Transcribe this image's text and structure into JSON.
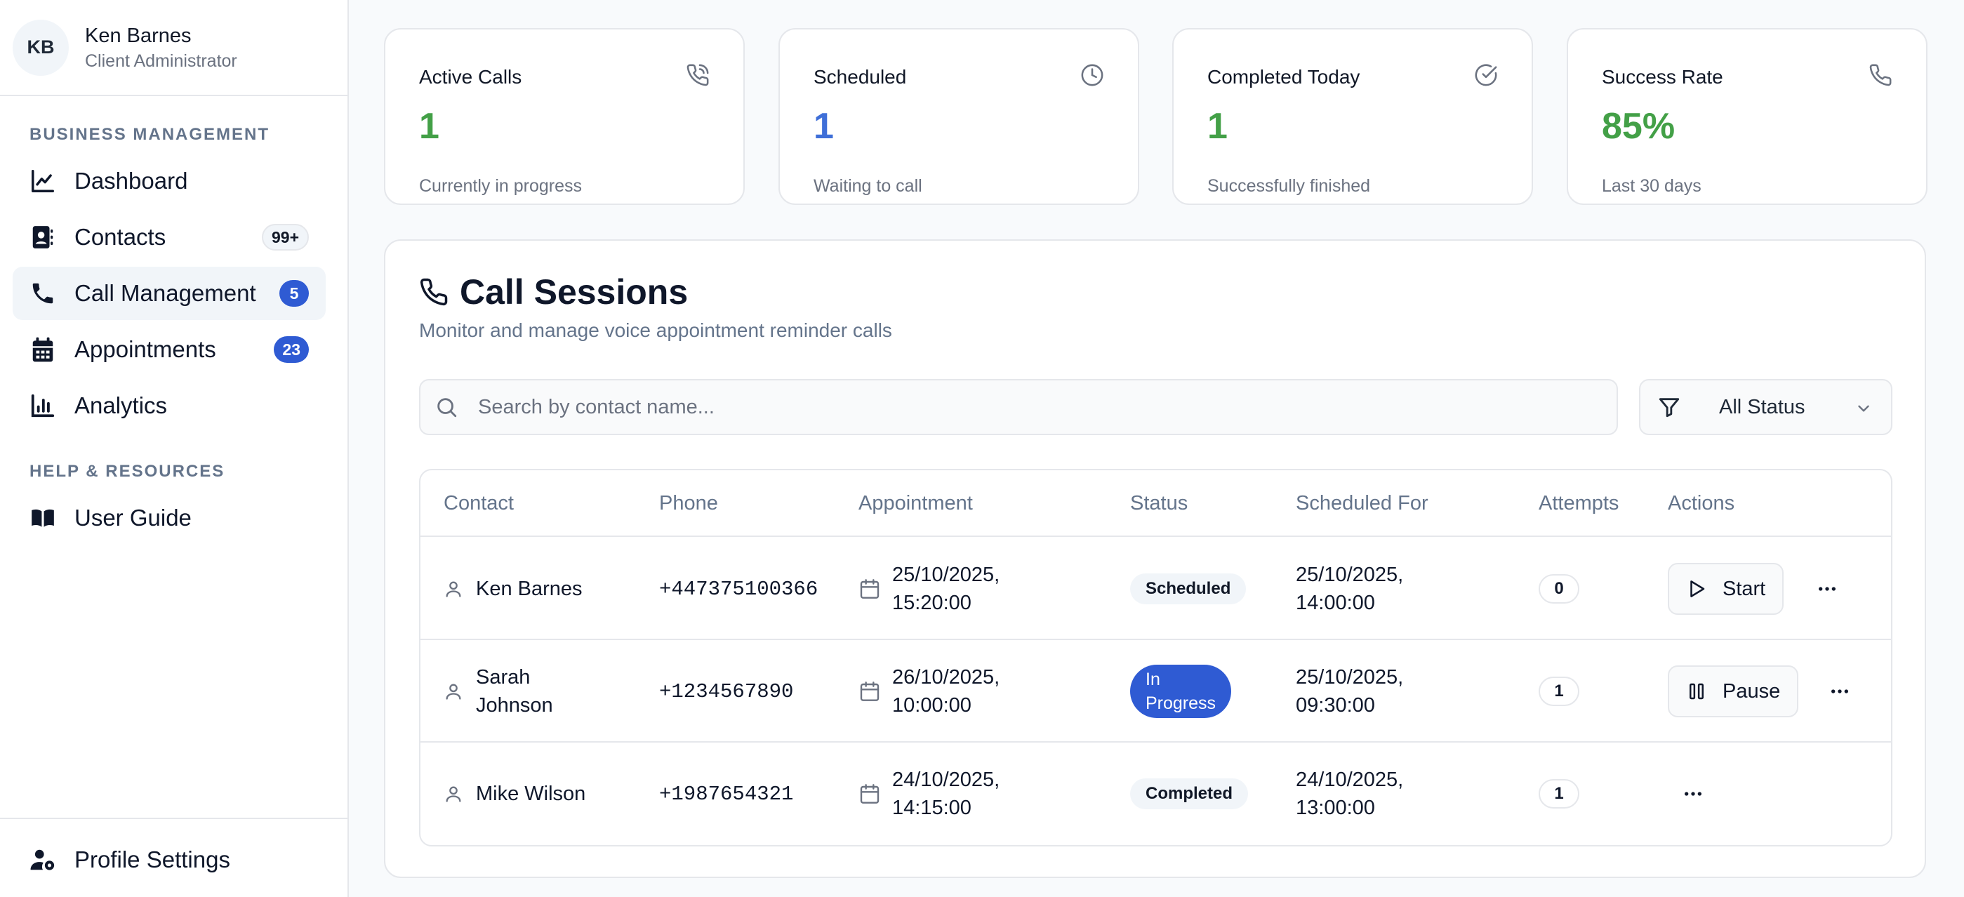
{
  "user": {
    "initials": "KB",
    "name": "Ken Barnes",
    "role": "Client Administrator"
  },
  "sidebar": {
    "section_business": "BUSINESS MANAGEMENT",
    "section_help": "HELP & RESOURCES",
    "items": [
      {
        "label": "Dashboard",
        "icon": "chart-line-icon"
      },
      {
        "label": "Contacts",
        "icon": "contacts-icon",
        "badge": "99+"
      },
      {
        "label": "Call Management",
        "icon": "phone-icon",
        "badge": "5",
        "active": true
      },
      {
        "label": "Appointments",
        "icon": "calendar-icon",
        "badge": "23"
      },
      {
        "label": "Analytics",
        "icon": "bar-chart-icon"
      }
    ],
    "help_items": [
      {
        "label": "User Guide",
        "icon": "book-icon"
      }
    ],
    "footer": {
      "label": "Profile Settings",
      "icon": "user-cog-icon"
    }
  },
  "stats": [
    {
      "title": "Active Calls",
      "value": "1",
      "sub": "Currently in progress",
      "icon": "phone-call-icon",
      "color": "#43a047"
    },
    {
      "title": "Scheduled",
      "value": "1",
      "sub": "Waiting to call",
      "icon": "clock-icon",
      "color": "#3f6fd8"
    },
    {
      "title": "Completed Today",
      "value": "1",
      "sub": "Successfully finished",
      "icon": "check-circle-icon",
      "color": "#43a047"
    },
    {
      "title": "Success Rate",
      "value": "85%",
      "sub": "Last 30 days",
      "icon": "phone-icon",
      "color": "#43a047"
    }
  ],
  "sessions": {
    "title": "Call Sessions",
    "subtitle": "Monitor and manage voice appointment reminder calls",
    "search_placeholder": "Search by contact name...",
    "filter_label": "All Status",
    "columns": [
      "Contact",
      "Phone",
      "Appointment",
      "Status",
      "Scheduled For",
      "Attempts",
      "Actions"
    ],
    "rows": [
      {
        "contact": "Ken Barnes",
        "phone": "+447375100366",
        "appt_date": "25/10/2025,",
        "appt_time": "15:20:00",
        "status": "Scheduled",
        "sched_date": "25/10/2025,",
        "sched_time": "14:00:00",
        "attempts": "0",
        "action": "Start"
      },
      {
        "contact_line1": "Sarah",
        "contact_line2": "Johnson",
        "phone": "+1234567890",
        "appt_date": "26/10/2025,",
        "appt_time": "10:00:00",
        "status_line1": "In",
        "status_line2": "Progress",
        "sched_date": "25/10/2025,",
        "sched_time": "09:30:00",
        "attempts": "1",
        "action": "Pause"
      },
      {
        "contact": "Mike Wilson",
        "phone": "+1987654321",
        "appt_date": "24/10/2025,",
        "appt_time": "14:15:00",
        "status": "Completed",
        "sched_date": "24/10/2025,",
        "sched_time": "13:00:00",
        "attempts": "1"
      }
    ]
  },
  "colors": {
    "accent": "#2f5bd3",
    "success": "#43a047",
    "info": "#3f6fd8"
  }
}
